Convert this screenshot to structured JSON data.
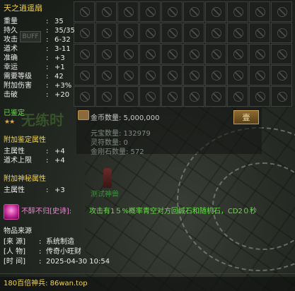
{
  "item": {
    "name": "天之逍遥扇",
    "stats": [
      {
        "key": "重量",
        "value": "35"
      },
      {
        "key": "持久",
        "value": "35/35"
      },
      {
        "key": "攻击",
        "value": "6-32"
      },
      {
        "key": "道术",
        "value": "3-11"
      },
      {
        "key": "准确",
        "value": "+3"
      },
      {
        "key": "幸运",
        "value": "+1"
      },
      {
        "key": "需要等级",
        "value": "42"
      },
      {
        "key": "附加伤害",
        "value": "+3%"
      },
      {
        "key": "击破",
        "value": "+20"
      }
    ],
    "identified_label": "已鉴定",
    "identified_stars": "★★",
    "faded_overlay_text": "无练时",
    "buff_tag": "BUFF",
    "identify_attr_title": "附加鉴定属性",
    "identify_attrs": [
      {
        "key": "主属性",
        "value": "+4"
      },
      {
        "key": "道术上限",
        "value": "+4"
      }
    ],
    "mystic_attr_title": "附加神秘属性",
    "mystic_attrs": [
      {
        "key": "主属性",
        "value": "+3"
      }
    ],
    "skill_name": "不醉不归[史诗]:",
    "skill_desc": "攻击有1５%概率青空对方回城石和随机石，CD2０秒",
    "source_title": "物品来源",
    "source": [
      {
        "key": "[来  源]",
        "value": "系统制造"
      },
      {
        "key": "[人  物]",
        "value": "传奇小旺财"
      },
      {
        "key": "[时  间]",
        "value": "2025-04-30 10:54"
      }
    ],
    "footer": "180百倍神兵: 86wan.top"
  },
  "currency": {
    "gold_label": "金币数量: 5,000,000",
    "yuanbao_label": "元宝数量: 132979",
    "lingfu_label": "灵符数量: 0",
    "jingangshi_label": "金刚石数量: 572",
    "button_label": "壹"
  },
  "scene": {
    "npc_name": "测试神兽"
  },
  "colors": {
    "title": "#f2d34a",
    "section": "#f2d34a",
    "identified": "#69e04a",
    "skill_name": "#e78bd0",
    "skill_desc": "#69e04a",
    "footer": "#f2d34a"
  }
}
